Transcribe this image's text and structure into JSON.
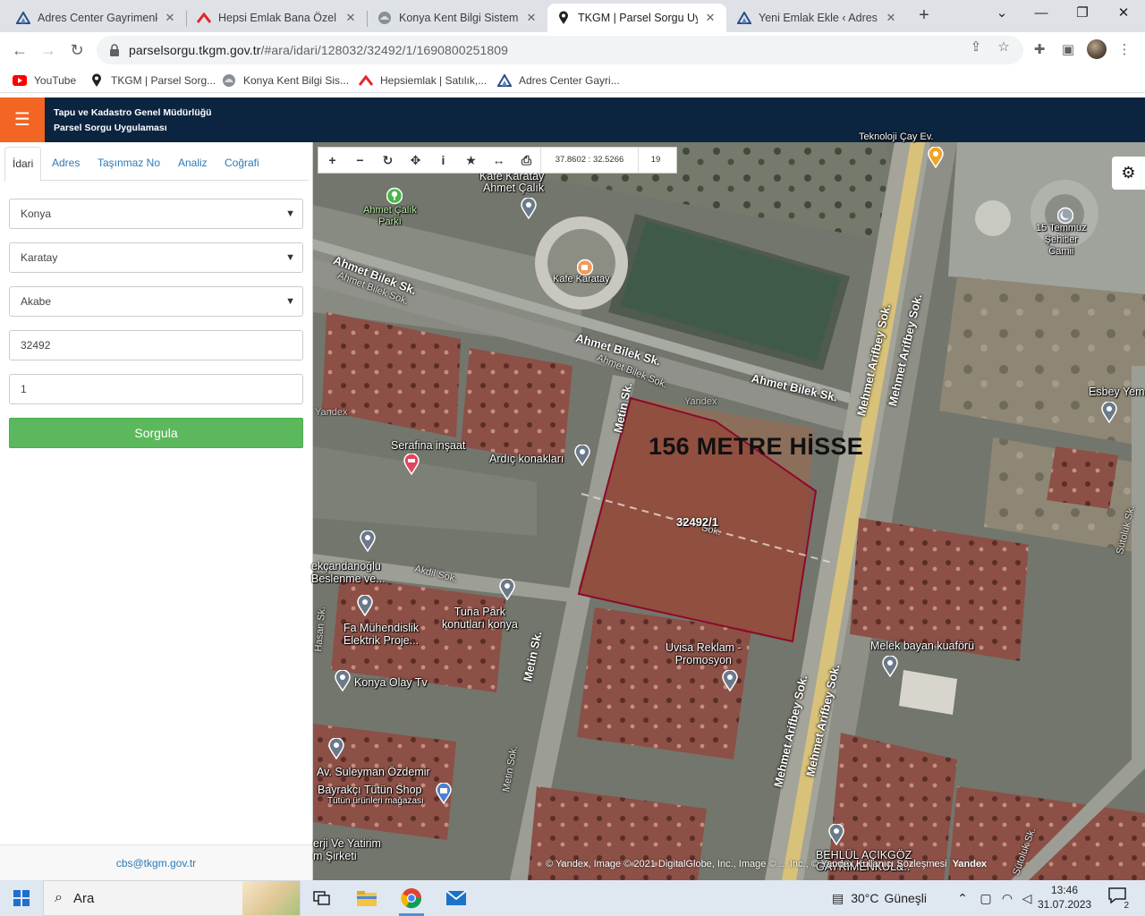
{
  "browser": {
    "tabs": [
      {
        "title": "Adres Center Gayrimenkul",
        "icon": "adres-center-icon",
        "active": false
      },
      {
        "title": "Hepsi Emlak Bana Özel",
        "icon": "hepsiemlak-icon",
        "active": false
      },
      {
        "title": "Konya Kent Bilgi Sistemi",
        "icon": "konya-kbs-icon",
        "active": false
      },
      {
        "title": "TKGM | Parsel Sorgu Uygu",
        "icon": "location-pin-icon",
        "active": true
      },
      {
        "title": "Yeni Emlak Ekle ‹ Adres Ce",
        "icon": "adres-center-icon",
        "active": false
      }
    ],
    "url_domain": "parselsorgu.tkgm.gov.tr",
    "url_path": "/#ara/idari/128032/32492/1/1690800251809",
    "bookmarks": [
      {
        "label": "YouTube",
        "icon": "youtube-icon"
      },
      {
        "label": "TKGM | Parsel Sorg...",
        "icon": "location-pin-icon"
      },
      {
        "label": "Konya Kent Bilgi Sis...",
        "icon": "konya-kbs-icon"
      },
      {
        "label": "Hepsiemlak | Satılık,...",
        "icon": "hepsiemlak-icon"
      },
      {
        "label": "Adres Center Gayri...",
        "icon": "adres-center-icon"
      }
    ]
  },
  "app": {
    "title_line1": "Tapu ve Kadastro Genel Müdürlüğü",
    "title_line2": "Parsel Sorgu Uygulaması",
    "accent": "#f26522",
    "header_bg": "#0b2440"
  },
  "sidebar": {
    "tabs": [
      "İdari",
      "Adres",
      "Taşınmaz No",
      "Analiz",
      "Coğrafi"
    ],
    "active_tab": "İdari",
    "il": "Konya",
    "ilce": "Karatay",
    "mahalle": "Akabe",
    "ada": "32492",
    "parsel": "1",
    "submit_label": "Sorgula",
    "footer_email": "cbs@tkgm.gov.tr"
  },
  "map": {
    "coordinates": "37.8602 : 32.5266",
    "zoom": "19",
    "annotation": "156 METRE HİSSE",
    "parcel_label": "32492/1",
    "parcel_outline_color": "#8b0a2a",
    "labels": {
      "park_name": "Ahmet Çalık\nParkı",
      "kafe_top": "Kafe Karatay",
      "ahmet_calik": "Ahmet Çalık",
      "kafe": "Kafe Karatay",
      "mosque": "15 Temmuz\nŞehitler\nCamii",
      "serafina": "Serafina inşaat",
      "ardic": "Ardıç konakları",
      "yandex_wm": "Yandex",
      "yandex_wm2": "Yandex",
      "ekcandanoglu": "ekçandanoğlu\nBeslenme ve...",
      "fa_muh": "Fa Mühendislik\nElektrik Proje...",
      "tuna": "Tuna Park\nkonutları konya",
      "uvisa": "Uvisa Reklam -\nPromosyon",
      "melek": "Melek bayan kuaförü",
      "esbey": "Esbey Yem",
      "konya_olay": "Konya Olay Tv",
      "av_suleyman": "Av. Suleyman Özdemir",
      "bayrakci": "Bayrakçı Tütün Shop",
      "bayrakci_sub": "Tütün ürünleri mağazası",
      "yatirim": "erji Ve Yatirim\nm Şirketi",
      "behlul": "BEHLÜL AÇIKGÖZ\nGAYRİMENKUL&..",
      "top_cut": "Teknoloji Çay Ev."
    },
    "streets": {
      "ahmet_bilek_1": "Ahmet Bilek Sk.",
      "ahmet_bilek_1b": "Ahmet Bilek Sok.",
      "ahmet_bilek_2": "Ahmet Bilek Sk.",
      "ahmet_bilek_2b": "Ahmet Bilek Sok.",
      "ahmet_bilek_3": "Ahmet Bilek Sk.",
      "mehmet_arifbey_1": "Mehmet Arifbey Sok.",
      "mehmet_arifbey_2": "Mehmet Arifbey Sok.",
      "mehmet_arifbey_3": "Mehmet Arifbey Sok.",
      "mehmet_arifbey_4": "Mehmet Arifbey Sok.",
      "metin_1": "Metin Sk.",
      "metin_2": "Metin Sk.",
      "metin_3": "Metin Sok.",
      "akdil": "Akdil Sok.",
      "hasan": "Hasan Sk.",
      "sutoluk_1": "Sütoluk Sk.",
      "sutoluk_2": "Sütoluk Sk.",
      "parcel_street": "Sok."
    },
    "attribution": "© Yandex, Image © 2021 DigitalGlobe, Inc., Image © ... Inc., © Yandex Kullanıcı Sözleşmesi",
    "attribution_brand": "Yandex"
  },
  "taskbar": {
    "search_placeholder": "Ara",
    "temperature": "30°C",
    "weather": "Güneşli",
    "time": "13:46",
    "date": "31.07.2023",
    "notification_count": "2"
  }
}
